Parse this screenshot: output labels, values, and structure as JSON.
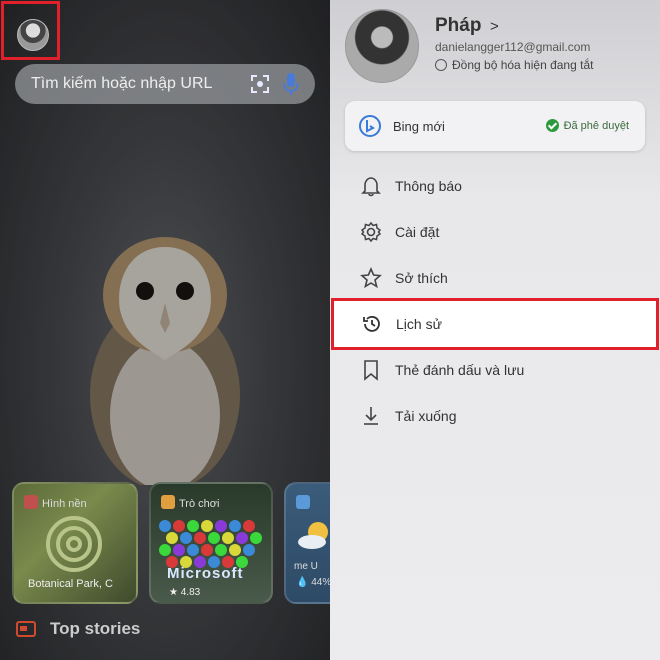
{
  "left": {
    "search": {
      "placeholder": "Tìm kiếm hoặc nhập URL"
    },
    "cards": [
      {
        "label": "Hình nền",
        "footer": "Botanical Park, C"
      },
      {
        "label": "Trò chơi",
        "title": "Microsoft",
        "rating": "★ 4.83"
      },
      {
        "label": "",
        "text": "me U",
        "percent": "💧 44%"
      }
    ],
    "top_stories": "Top stories"
  },
  "right": {
    "profile": {
      "name": "Pháp",
      "chevron": ">",
      "email": "danielangger112@gmail.com",
      "sync_status": "Đồng bộ hóa hiện đang tắt"
    },
    "bing": {
      "label": "Bing mới",
      "status": "Đã phê duyệt"
    },
    "menu": [
      {
        "label": "Thông báo",
        "icon": "bell-icon"
      },
      {
        "label": "Cài đặt",
        "icon": "gear-icon"
      },
      {
        "label": "Sở thích",
        "icon": "star-icon"
      },
      {
        "label": "Lịch sử",
        "icon": "history-icon"
      },
      {
        "label": "Thẻ đánh dấu và lưu",
        "icon": "bookmark-icon"
      },
      {
        "label": "Tải xuống",
        "icon": "download-icon"
      }
    ]
  },
  "colors": {
    "highlight": "#e0202a",
    "approved": "#2c9a3c",
    "accent": "#d04a30"
  }
}
